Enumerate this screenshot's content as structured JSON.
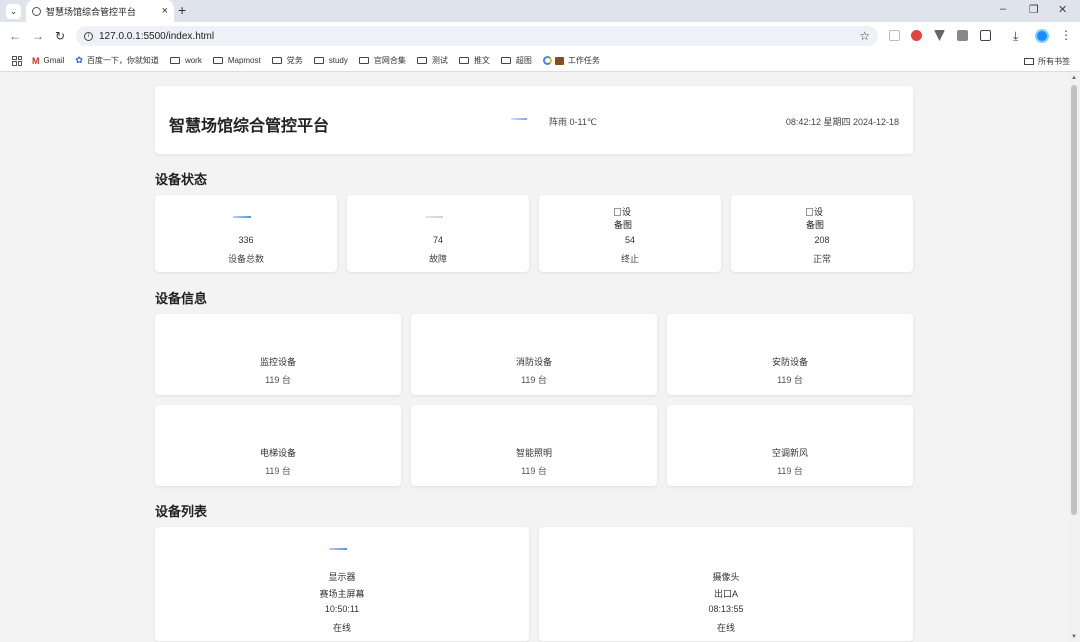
{
  "browser": {
    "tab_title": "智慧场馆综合管控平台",
    "tab_close": "×",
    "new_tab": "+",
    "url": "127.0.0.1:5500/index.html",
    "bookmarks": [
      {
        "label": "Gmail",
        "icon": "gmail-icon"
      },
      {
        "label": "百度一下，你就知道",
        "icon": "baidu-paw-icon"
      },
      {
        "label": "work",
        "icon": "folder-icon"
      },
      {
        "label": "Mapmost",
        "icon": "folder-icon"
      },
      {
        "label": "党务",
        "icon": "folder-icon"
      },
      {
        "label": "study",
        "icon": "folder-icon"
      },
      {
        "label": "官网合集",
        "icon": "folder-icon"
      },
      {
        "label": "测试",
        "icon": "folder-icon"
      },
      {
        "label": "推文",
        "icon": "folder-icon"
      },
      {
        "label": "超图",
        "icon": "folder-icon"
      },
      {
        "label": "工作任务",
        "icon": "briefcase-icon"
      }
    ],
    "all_bookmarks": "所有书签"
  },
  "header": {
    "title": "智慧场馆综合管控平台",
    "weather": "阵雨 0-11℃",
    "datetime": "08:42:12  星期四 2024-12-18"
  },
  "sections": {
    "status": "设备状态",
    "info": "设备信息",
    "list": "设备列表"
  },
  "status_cards": [
    {
      "value": "336",
      "label": "设备总数",
      "icon": "bar-icon"
    },
    {
      "value": "74",
      "label": "故障",
      "icon": "bar-icon"
    },
    {
      "value": "54",
      "label": "终止",
      "icon": "broken-image",
      "alt_line1": "设",
      "alt_line2": "备图"
    },
    {
      "value": "208",
      "label": "正常",
      "icon": "broken-image",
      "alt_line1": "设",
      "alt_line2": "备图"
    }
  ],
  "info_cards": [
    {
      "name": "监控设备",
      "count": "119 台"
    },
    {
      "name": "消防设备",
      "count": "119 台"
    },
    {
      "name": "安防设备",
      "count": "119 台"
    },
    {
      "name": "电梯设备",
      "count": "119 台"
    },
    {
      "name": "智能照明",
      "count": "119 台"
    },
    {
      "name": "空调新风",
      "count": "119 台"
    }
  ],
  "device_list": [
    {
      "type": "显示器",
      "location": "赛场主屏幕",
      "time": "10:50:11",
      "status": "在线"
    },
    {
      "type": "摄像头",
      "location": "出口A",
      "time": "08:13:55",
      "status": "在线"
    }
  ]
}
